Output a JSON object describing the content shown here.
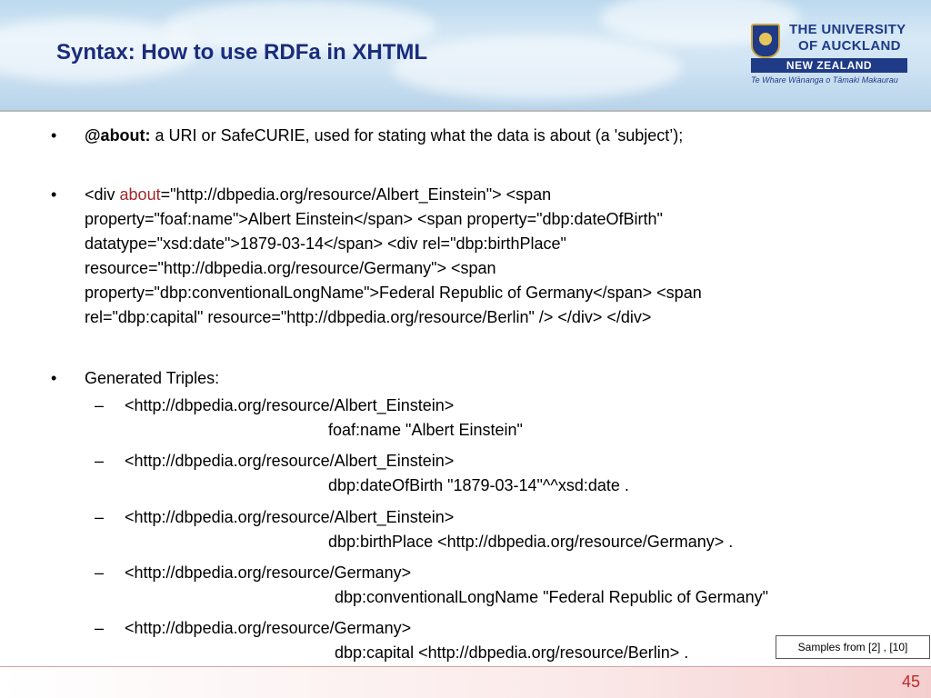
{
  "header": {
    "title": "Syntax: How to use RDFa in XHTML",
    "logo": {
      "line1": "THE UNIVERSITY",
      "line2": "OF AUCKLAND",
      "banner": "NEW ZEALAND",
      "maori": "Te Whare Wānanga o Tāmaki Makaurau"
    }
  },
  "bullets": {
    "b1_label": "@about:",
    "b1_text": " a URI or SafeCURIE, used for stating what the data is about (a 'subject’);",
    "b2_line1_pre": "<div ",
    "b2_line1_kw": "about",
    "b2_line1_post": "=\"http://dbpedia.org/resource/Albert_Einstein\"> <span",
    "b2_line2": "property=\"foaf:name\">Albert Einstein</span> <span property=\"dbp:dateOfBirth\"",
    "b2_line3": "datatype=\"xsd:date\">1879-03-14</span> <div rel=\"dbp:birthPlace\"",
    "b2_line4": "resource=\"http://dbpedia.org/resource/Germany\"> <span",
    "b2_line5": "property=\"dbp:conventionalLongName\">Federal Republic of Germany</span> <span",
    "b2_line6": "rel=\"dbp:capital\" resource=\"http://dbpedia.org/resource/Berlin\" /> </div> </div>",
    "b3_text": "Generated Triples:"
  },
  "triples": [
    {
      "subject": "<http://dbpedia.org/resource/Albert_Einstein>",
      "rest": "foaf:name \"Albert Einstein\""
    },
    {
      "subject": "<http://dbpedia.org/resource/Albert_Einstein>",
      "rest": "dbp:dateOfBirth \"1879-03-14\"^^xsd:date ."
    },
    {
      "subject": "<http://dbpedia.org/resource/Albert_Einstein>",
      "rest": "dbp:birthPlace <http://dbpedia.org/resource/Germany> ."
    },
    {
      "subject": "<http://dbpedia.org/resource/Germany>",
      "rest": "dbp:conventionalLongName \"Federal Republic of Germany\""
    },
    {
      "subject": "<http://dbpedia.org/resource/Germany>",
      "rest": "dbp:capital <http://dbpedia.org/resource/Berlin> ."
    }
  ],
  "bullet_char": "•",
  "dash_char": "–",
  "samples_note": "Samples from [2] , [10]",
  "page_number": "45",
  "colors": {
    "title": "#1a2c7a",
    "keyword": "#a0282a",
    "page_number": "#c0282a"
  }
}
